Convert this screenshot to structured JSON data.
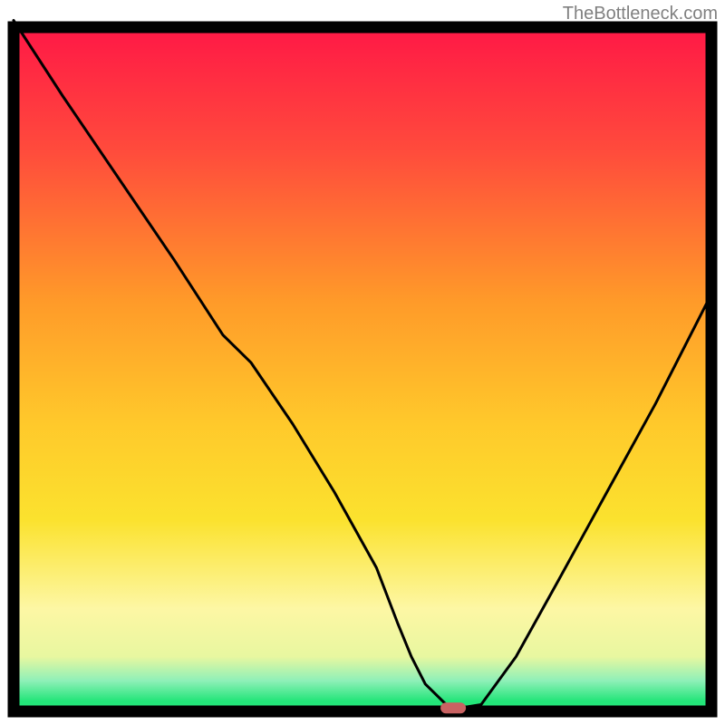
{
  "watermark": "TheBottleneck.com",
  "colors": {
    "border": "#000000",
    "curve": "#000000",
    "marker_fill": "#c96262",
    "gradient_top": "#ff1846",
    "gradient_orange": "#ff9a29",
    "gradient_yellow": "#fbe22e",
    "gradient_paleyellow": "#fdf7a4",
    "gradient_green": "#23e579",
    "gradient_lightgreen": "#8ff0b8"
  },
  "chart_data": {
    "type": "line",
    "title": "",
    "xlabel": "",
    "ylabel": "",
    "xlim": [
      0,
      100
    ],
    "ylim": [
      0,
      100
    ],
    "grid": false,
    "legend": false,
    "x": [
      0,
      7,
      15,
      23,
      30,
      34,
      40,
      46,
      52,
      55,
      57,
      59,
      62,
      64,
      67,
      72,
      78,
      85,
      92,
      100
    ],
    "values": [
      101,
      90,
      78,
      66,
      55,
      51,
      42,
      32,
      21,
      13,
      8,
      4,
      1,
      0.5,
      1,
      8,
      19,
      32,
      45,
      61
    ],
    "marker": {
      "x": 63,
      "y": 0.5
    },
    "annotations": []
  }
}
